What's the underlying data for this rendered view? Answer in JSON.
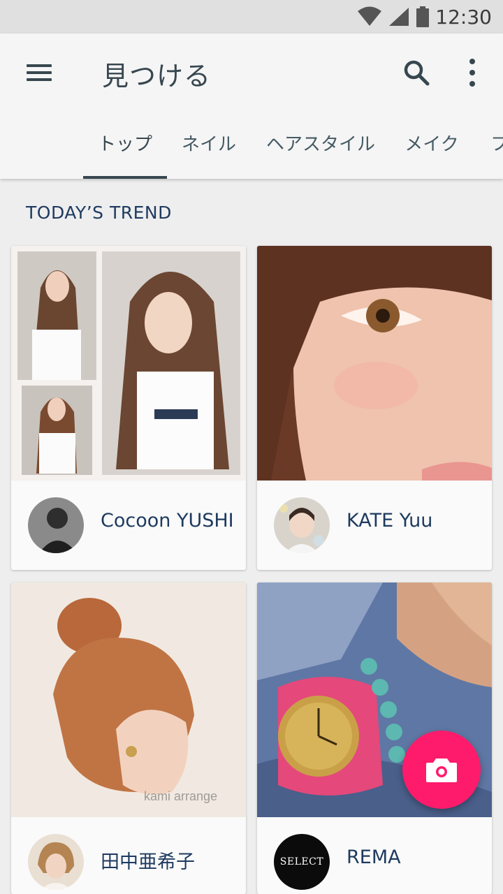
{
  "status_bar": {
    "time": "12:30",
    "icons": [
      "wifi-icon",
      "signal-icon",
      "battery-icon"
    ]
  },
  "app_bar": {
    "title": "見つける",
    "icons": [
      "menu-icon",
      "search-icon",
      "more-vert-icon"
    ]
  },
  "tabs": [
    {
      "label": "トップ",
      "active": true
    },
    {
      "label": "ネイル",
      "active": false
    },
    {
      "label": "ヘアスタイル",
      "active": false
    },
    {
      "label": "メイク",
      "active": false
    },
    {
      "label": "フ",
      "active": false
    }
  ],
  "section": {
    "title": "TODAY’S TREND"
  },
  "cards": [
    {
      "user_name": "Cocoon YUSHI"
    },
    {
      "user_name": "KATE Yuu"
    },
    {
      "user_name": "田中亜希子",
      "photo_caption": "kami arrange"
    },
    {
      "user_name": "REMA",
      "avatar_text": "SELECT"
    }
  ],
  "fab": {
    "icon": "camera-icon"
  },
  "colors": {
    "accent": "#ff1b6b",
    "toolbar_text": "#37474f",
    "card_text": "#1e3a5f",
    "background": "#eeeeee"
  }
}
